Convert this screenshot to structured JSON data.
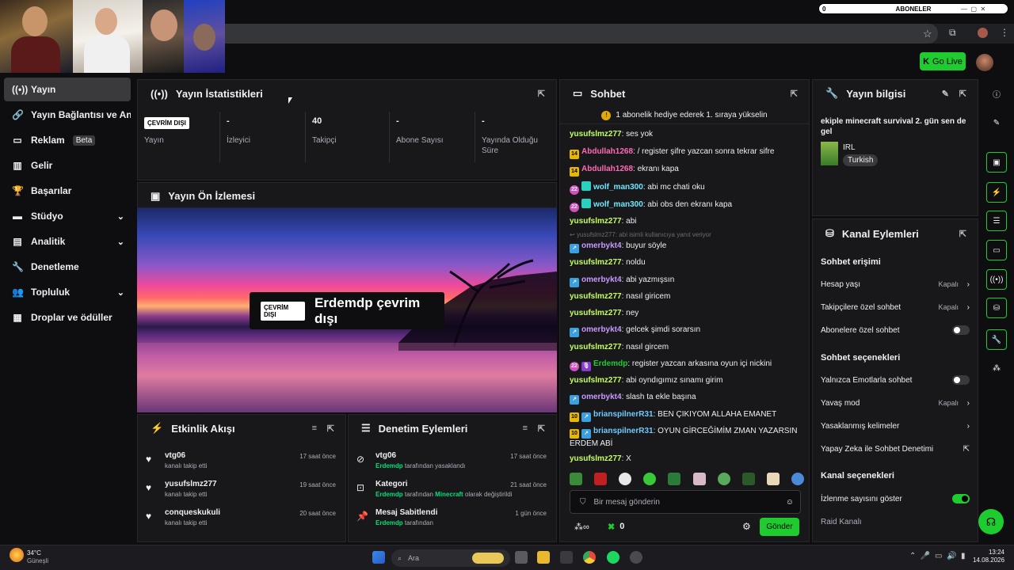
{
  "webcam": {
    "cams": [
      "cam-1",
      "cam-2",
      "cam-3",
      "cam-4"
    ]
  },
  "subscriber_goal": {
    "current": "0",
    "label": "ABONELER"
  },
  "topbar": {
    "go_live": "Go Live"
  },
  "sidebar": {
    "items": [
      {
        "label": "Yayın",
        "icon": "broadcast-icon"
      },
      {
        "label": "Yayın Bağlantısı ve Anahtarı",
        "icon": "link-icon"
      },
      {
        "label": "Reklam",
        "icon": "ad-icon",
        "badge": "Beta"
      },
      {
        "label": "Gelir",
        "icon": "chart-icon"
      },
      {
        "label": "Başarılar",
        "icon": "trophy-icon"
      },
      {
        "label": "Stüdyo",
        "icon": "studio-icon"
      },
      {
        "label": "Analitik",
        "icon": "analytics-icon"
      },
      {
        "label": "Denetleme",
        "icon": "wrench-icon"
      },
      {
        "label": "Topluluk",
        "icon": "community-icon"
      },
      {
        "label": "Droplar ve ödüller",
        "icon": "drops-icon"
      }
    ]
  },
  "stats": {
    "title": "Yayın İstatistikleri",
    "offline": "ÇEVRİM DIŞI",
    "items": [
      {
        "value": "",
        "label": "Yayın"
      },
      {
        "value": "-",
        "label": "İzleyici"
      },
      {
        "value": "40",
        "label": "Takipçi"
      },
      {
        "value": "-",
        "label": "Abone Sayısı"
      },
      {
        "value": "-",
        "label": "Yayında Olduğu Süre"
      }
    ]
  },
  "preview": {
    "title": "Yayın Ön İzlemesi",
    "badge": "ÇEVRİM DIŞI",
    "status": "Erdemdp çevrim dışı"
  },
  "activity": {
    "title": "Etkinlik Akışı",
    "items": [
      {
        "name": "vtg06",
        "sub": "kanalı takip etti",
        "time": "17 saat önce"
      },
      {
        "name": "yusufslmz277",
        "sub": "kanalı takip etti",
        "time": "19 saat önce"
      },
      {
        "name": "conqueskukuli",
        "sub": "kanalı takip etti",
        "time": "20 saat önce"
      }
    ]
  },
  "moderation": {
    "title": "Denetim Eylemleri",
    "items": [
      {
        "name": "vtg06",
        "actor": "Erdemdp",
        "sub": " tarafından yasaklandı",
        "extra": "",
        "time": "17 saat önce"
      },
      {
        "name": "Kategori",
        "actor": "Erdemdp",
        "sub": " tarafından ",
        "extra": "Minecraft",
        "tail": " olarak değiştirildi",
        "time": "21 saat önce"
      },
      {
        "name": "Mesaj Sabitlendi",
        "actor": "Erdemdp",
        "sub": " tarafından",
        "extra": "",
        "time": "1 gün önce"
      }
    ]
  },
  "chat": {
    "title": "Sohbet",
    "pinned": "1 abonelik hediye ederek 1. sıraya yükselin",
    "reply_hint": "yusufslmz277: abi isimli kullanıcıya yanıt veriyor",
    "messages": [
      {
        "user": "yusufslmz277",
        "text": "ses yok",
        "color": "#c6ff5e"
      },
      {
        "user": "Abdullah1268",
        "text": "/ register şifre yazcan sonra tekrar sifre",
        "color": "#ff69b4",
        "badge": "14"
      },
      {
        "user": "Abdullah1268",
        "text": "ekranı kapa",
        "color": "#ff69b4",
        "badge": "14"
      },
      {
        "user": "wolf_man300",
        "text": "abi mc chati oku",
        "color": "#6ee7ff",
        "badge": "22"
      },
      {
        "user": "wolf_man300",
        "text": "abi obs den ekranı kapa",
        "color": "#6ee7ff",
        "badge": "22"
      },
      {
        "user": "yusufslmz277",
        "text": "abi",
        "color": "#c6ff5e"
      },
      {
        "user": "omerbykt4",
        "text": "buyur söyle",
        "color": "#c79aff"
      },
      {
        "user": "yusufslmz277",
        "text": "noldu",
        "color": "#c6ff5e"
      },
      {
        "user": "omerbykt4",
        "text": "abi yazmışsın",
        "color": "#c79aff"
      },
      {
        "user": "yusufslmz277",
        "text": "nasıl giricem",
        "color": "#c6ff5e"
      },
      {
        "user": "yusufslmz277",
        "text": "ney",
        "color": "#c6ff5e"
      },
      {
        "user": "omerbykt4",
        "text": "gelcek şimdi sorarsın",
        "color": "#c79aff"
      },
      {
        "user": "yusufslmz277",
        "text": "nasıl gircem",
        "color": "#c6ff5e"
      },
      {
        "user": "Erdemdp",
        "text": "register yazcan arkasına oyun içi nickini",
        "color": "#1fcc30",
        "badge": "22"
      },
      {
        "user": "yusufslmz277",
        "text": "abi oyndıgımız sınamı girim",
        "color": "#c6ff5e"
      },
      {
        "user": "omerbykt4",
        "text": "slash ta ekle başına",
        "color": "#c79aff"
      },
      {
        "user": "brianspilnerR31",
        "text": "BEN ÇIKIYOM ALLAHA EMANET",
        "color": "#6ecbff",
        "badge": "10"
      },
      {
        "user": "brianspilnerR31",
        "text": "OYUN GİRCEĞİMİM ZMAN YAZARSIN ERDEM ABİ",
        "color": "#6ecbff",
        "badge": "10"
      },
      {
        "user": "yusufslmz277",
        "text": "X",
        "color": "#c6ff5e"
      }
    ],
    "placeholder": "Bir mesaj gönderin",
    "points": "0",
    "send": "Gönder"
  },
  "stream_info": {
    "title": "Yayın bilgisi",
    "stream_title": "ekiple minecraft survival 2. gün sen de gel",
    "category": "IRL",
    "language": "Turkish"
  },
  "channel_actions": {
    "title": "Kanal Eylemleri",
    "chat_access": "Sohbet erişimi",
    "rows1": [
      {
        "label": "Hesap yaşı",
        "value": "Kapalı"
      },
      {
        "label": "Takipçilere özel sohbet",
        "value": "Kapalı"
      },
      {
        "label": "Abonelere özel sohbet"
      }
    ],
    "chat_options": "Sohbet seçenekleri",
    "rows2": [
      {
        "label": "Yalnızca Emotlarla sohbet"
      },
      {
        "label": "Yavaş mod",
        "value": "Kapalı"
      },
      {
        "label": "Yasaklanmış kelimeler"
      },
      {
        "label": "Yapay Zeka ile Sohbet Denetimi"
      }
    ],
    "channel_options": "Kanal seçenekleri",
    "rows3": [
      {
        "label": "İzlenme sayısını göster"
      },
      {
        "label": "Raid Kanalı"
      }
    ]
  },
  "taskbar": {
    "temp": "34°C",
    "weather": "Güneşli",
    "search": "Ara",
    "time": "13:24",
    "date": "14.08.2026"
  }
}
